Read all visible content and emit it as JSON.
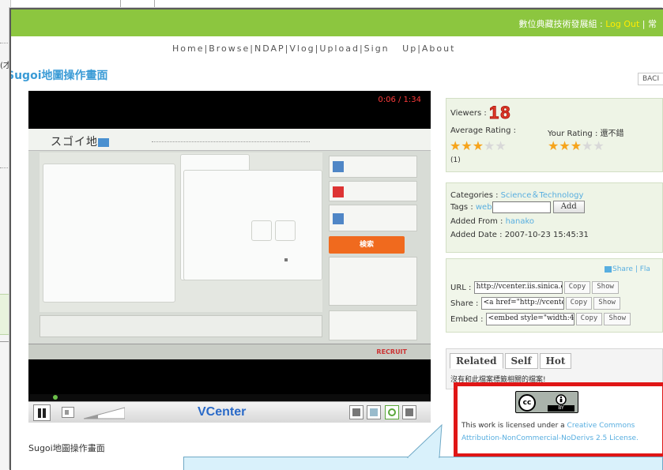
{
  "topbar": {
    "user_text": "數位典藏技術發展組",
    "separator": " : ",
    "logout_label": "Log Out",
    "pipe": " | ",
    "overflow_text": "常"
  },
  "nav": {
    "items": [
      "Home",
      "Browse",
      "NDAP",
      "Vlog",
      "Upload",
      "Sign   Up",
      "About"
    ]
  },
  "background": {
    "left_char": "(才"
  },
  "page": {
    "title": "Sugoi地圖操作畫面",
    "caption": "Sugoi地圖操作畫面"
  },
  "player": {
    "timecode": "0:06 / 1:34",
    "brand": "VCenter",
    "video_logo": "スゴイ地",
    "video_footer_brand": "RECRUIT",
    "video_search_label": "検索",
    "progress_fraction": 0.06
  },
  "sidebar": {
    "back_label": "BACI",
    "viewers_label": "Viewers :",
    "viewers_count": "18",
    "average_rating_label": "Average Rating :",
    "your_rating_label": "Your Rating : 還不錯",
    "average_stars": 3,
    "your_stars": 3,
    "max_stars": 5,
    "rating_count": "(1)",
    "categories_label": "Categories :",
    "categories_value": "Science＆Technology",
    "tags_label": "Tags :",
    "tags_value": "web",
    "add_label": "Add",
    "added_from_label": "Added From :",
    "added_from_value": "hanako",
    "added_date_label": "Added Date :",
    "added_date_value": "2007-10-23 15:45:31",
    "share_links": "Share | Fla",
    "url_label": "URL :",
    "url_value": "http://vcenter.iis.sinica.edu.t",
    "share_label": "Share :",
    "share_value": "<a href=\"http://vcenter.iis.si",
    "embed_label": "Embed :",
    "embed_value": "<embed style=\"width:480px",
    "copy_label": "Copy",
    "show_label": "Show",
    "tabs": [
      "Related",
      "Self",
      "Hot"
    ],
    "related_text": "沒有和此檔案標籤相關的檔案!"
  },
  "license": {
    "badge_cc": "cc",
    "badge_by": "BY",
    "line1_prefix": "This work is licensed under a ",
    "line1_link": "Creative Commons",
    "line2_link": "Attribution-NonCommercial-NoDerivs 2.5 License."
  },
  "colors": {
    "topbar_green": "#8cc63f",
    "title_blue": "#3a9bd6",
    "link_blue": "#58aee0",
    "highlight_red": "#e01616",
    "star_orange": "#f6a41c",
    "callout_fill": "#d9f1fb"
  }
}
